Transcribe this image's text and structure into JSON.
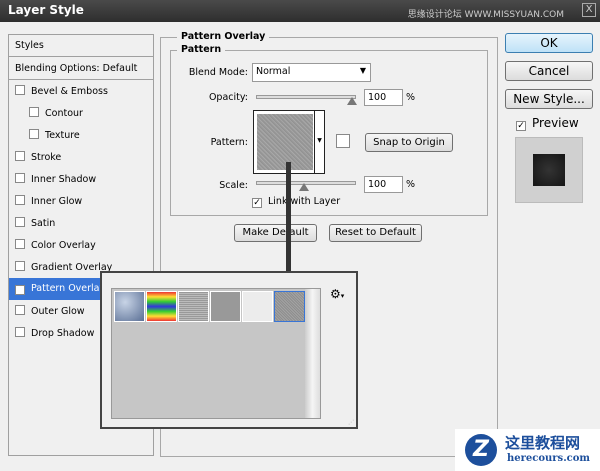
{
  "window": {
    "title": "Layer Style",
    "watermark_top": "思缘设计论坛 WWW.MISSYUAN.COM",
    "close": "X"
  },
  "sidebar": {
    "items": [
      {
        "label": "Styles",
        "type": "header"
      },
      {
        "label": "Blending Options: Default",
        "type": "header"
      },
      {
        "label": "Bevel & Emboss",
        "checked": false
      },
      {
        "label": "Contour",
        "checked": false,
        "indent": true
      },
      {
        "label": "Texture",
        "checked": false,
        "indent": true
      },
      {
        "label": "Stroke",
        "checked": false
      },
      {
        "label": "Inner Shadow",
        "checked": false
      },
      {
        "label": "Inner Glow",
        "checked": false
      },
      {
        "label": "Satin",
        "checked": false
      },
      {
        "label": "Color Overlay",
        "checked": false
      },
      {
        "label": "Gradient Overlay",
        "checked": false
      },
      {
        "label": "Pattern Overlay",
        "checked": true,
        "selected": true
      },
      {
        "label": "Outer Glow",
        "checked": false
      },
      {
        "label": "Drop Shadow",
        "checked": false
      }
    ]
  },
  "panel": {
    "group_title": "Pattern Overlay",
    "sub_title": "Pattern",
    "blend_mode_label": "Blend Mode:",
    "blend_mode": "Normal",
    "opacity_label": "Opacity:",
    "opacity": "100",
    "opacity_unit": "%",
    "pattern_label": "Pattern:",
    "snap_label": "Snap to Origin",
    "scale_label": "Scale:",
    "scale": "100",
    "scale_unit": "%",
    "link_label": "Link with Layer",
    "link_checked": true,
    "make_default": "Make Default",
    "reset_default": "Reset to Default"
  },
  "buttons": {
    "ok": "OK",
    "cancel": "Cancel",
    "new_style": "New Style...",
    "preview_label": "Preview",
    "preview_checked": true
  },
  "picker": {
    "patterns": [
      "Bubbles",
      "Tie Dye",
      "Laid-Horizontal",
      "Fine Grain",
      "Gray Granite",
      "Custom Noise"
    ],
    "selected_index": 5
  },
  "watermark": {
    "title": "这里教程网",
    "url": "herecours.com"
  }
}
